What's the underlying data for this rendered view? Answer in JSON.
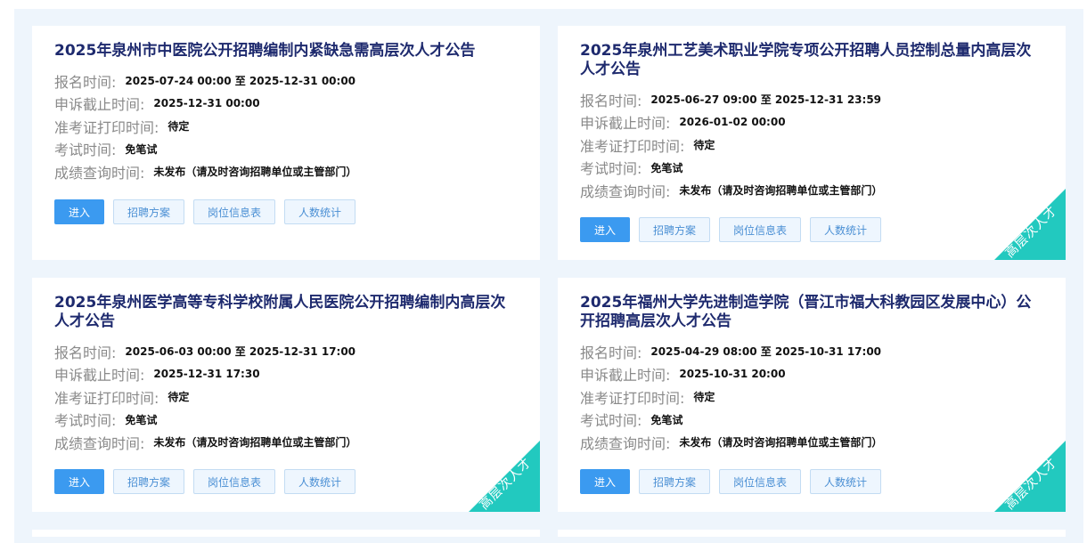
{
  "labels": {
    "signup": "报名时间:",
    "appeal": "申诉截止时间:",
    "ticket": "准考证打印时间:",
    "exam": "考试时间:",
    "score": "成绩查询时间:"
  },
  "buttons": {
    "enter": "进入",
    "plan": "招聘方案",
    "positions": "岗位信息表",
    "stats": "人数统计"
  },
  "ribbon_text": "高层次人才",
  "cards": [
    {
      "title": "2025年泉州市中医院公开招聘编制内紧缺急需高层次人才公告",
      "signup": "2025-07-24 00:00 至 2025-12-31 00:00",
      "appeal": "2025-12-31 00:00",
      "ticket": "待定",
      "exam": "免笔试",
      "score": "未发布（请及时咨询招聘单位或主管部门）"
    },
    {
      "title": "2025年泉州工艺美术职业学院专项公开招聘人员控制总量内高层次人才公告",
      "signup": "2025-06-27 09:00 至 2025-12-31 23:59",
      "appeal": "2026-01-02 00:00",
      "ticket": "待定",
      "exam": "免笔试",
      "score": "未发布（请及时咨询招聘单位或主管部门）"
    },
    {
      "title": "2025年泉州医学高等专科学校附属人民医院公开招聘编制内高层次人才公告",
      "signup": "2025-06-03 00:00 至 2025-12-31 17:00",
      "appeal": "2025-12-31 17:30",
      "ticket": "待定",
      "exam": "免笔试",
      "score": "未发布（请及时咨询招聘单位或主管部门）"
    },
    {
      "title": "2025年福州大学先进制造学院（晋江市福大科教园区发展中心）公开招聘高层次人才公告",
      "signup": "2025-04-29 08:00 至 2025-10-31 17:00",
      "appeal": "2025-10-31 20:00",
      "ticket": "待定",
      "exam": "免笔试",
      "score": "未发布（请及时咨询招聘单位或主管部门）"
    }
  ]
}
